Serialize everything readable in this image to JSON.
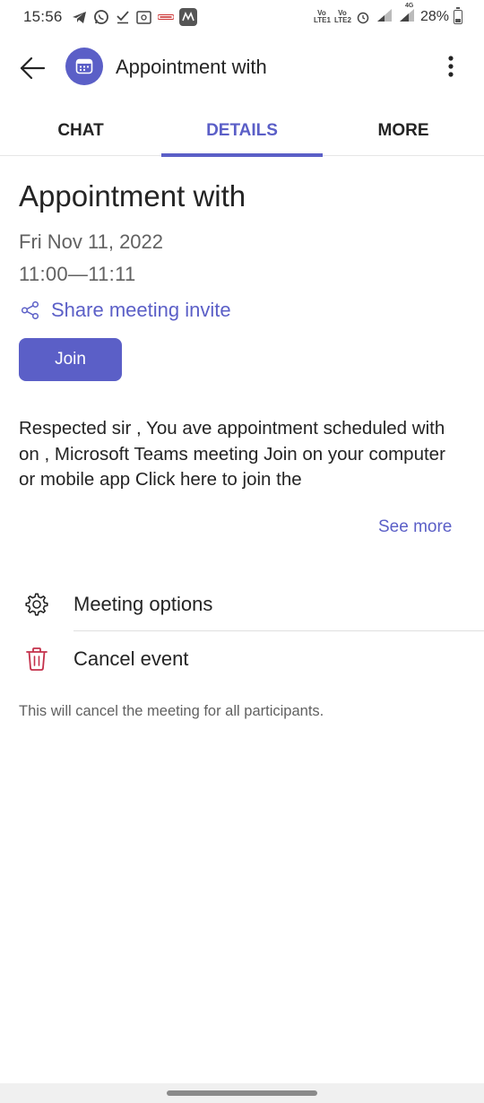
{
  "status_bar": {
    "time": "15:56",
    "notification_icons": [
      "telegram-icon",
      "whatsapp-icon",
      "checkmark-icon",
      "screenshot-icon",
      "paytm-icon",
      "myntra-icon"
    ],
    "sim1": "Vo LTE1",
    "sim2": "Vo LTE2",
    "network": "4G",
    "battery": "28%",
    "battery_level": 0.28
  },
  "header": {
    "title": "Appointment with",
    "avatar_icon": "calendar-icon",
    "accent_color": "#5b5fc7"
  },
  "tabs": [
    {
      "label": "CHAT",
      "active": false
    },
    {
      "label": "DETAILS",
      "active": true
    },
    {
      "label": "MORE",
      "active": false
    }
  ],
  "details": {
    "title": "Appointment with",
    "date": "Fri Nov 11, 2022",
    "time": "11:00—11:11",
    "share_label": "Share meeting invite",
    "join_label": "Join",
    "description": "Respected sir , You ave appointment scheduled with on ,  Microsoft Teams meeting Join on your computer or mobile app Click here to join the",
    "see_more": "See more"
  },
  "options": {
    "meeting_options": "Meeting options",
    "cancel_event": "Cancel event",
    "cancel_note": "This will cancel the meeting for all participants.",
    "cancel_color": "#c4314b"
  }
}
